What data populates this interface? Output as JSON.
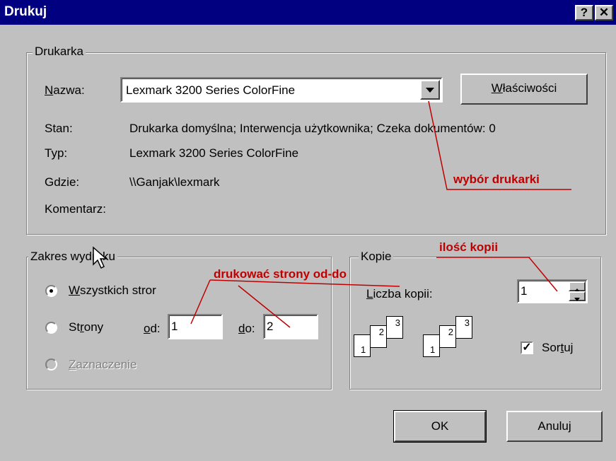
{
  "dialog": {
    "title": "Drukuj",
    "help_button": "?",
    "close_button": "✕"
  },
  "printer": {
    "group_label": "Drukarka",
    "name_label": "Nazwa:",
    "name_value": "Lexmark 3200 Series ColorFine",
    "properties_button": "Właściwości",
    "status_label": "Stan:",
    "status_value": "Drukarka domyślna; Interwencja użytkownika; Czeka dokumentów: 0",
    "type_label": "Typ:",
    "type_value": "Lexmark 3200 Series ColorFine",
    "where_label": "Gdzie:",
    "where_value": "\\\\Ganjak\\lexmark",
    "comment_label": "Komentarz:"
  },
  "range": {
    "group_label": "Zakres wydruku",
    "all_label": "Wszystkich stron",
    "pages_label": "Strony",
    "from_label": "od:",
    "from_value": "1",
    "to_label": "do:",
    "to_value": "2",
    "selection_label": "Zaznaczenie"
  },
  "copies": {
    "group_label": "Kopie",
    "count_label": "Liczba kopii:",
    "count_value": "1",
    "collate_label": "Sortuj",
    "collate_checked": true,
    "page_numbers": [
      "1",
      "2",
      "3"
    ]
  },
  "buttons": {
    "ok": "OK",
    "cancel": "Anuluj"
  },
  "annotations": {
    "printer_choice": "wybór drukarki",
    "copies_count": "ilość kopii",
    "page_range": "drukować strony od-do",
    "color": "#c00000"
  }
}
